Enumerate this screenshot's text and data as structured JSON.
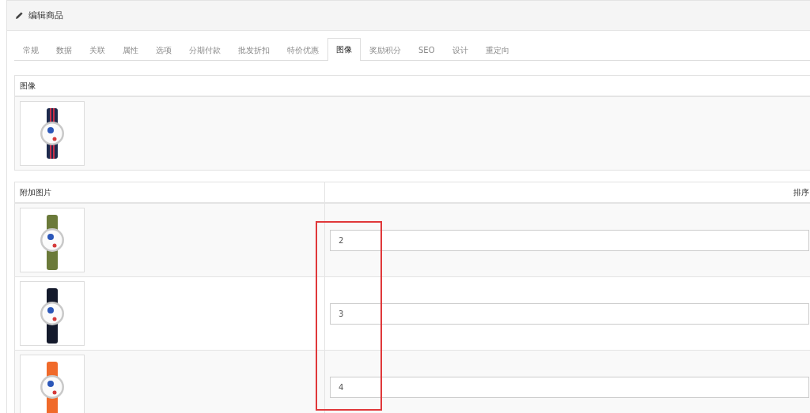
{
  "panel": {
    "title": "编辑商品"
  },
  "tabs": [
    {
      "label": "常规",
      "selected": false
    },
    {
      "label": "数据",
      "selected": false
    },
    {
      "label": "关联",
      "selected": false
    },
    {
      "label": "属性",
      "selected": false
    },
    {
      "label": "选项",
      "selected": false
    },
    {
      "label": "分期付款",
      "selected": false
    },
    {
      "label": "批发折扣",
      "selected": false
    },
    {
      "label": "特价优惠",
      "selected": false
    },
    {
      "label": "图像",
      "selected": true
    },
    {
      "label": "奖励积分",
      "selected": false
    },
    {
      "label": "SEO",
      "selected": false
    },
    {
      "label": "设计",
      "selected": false
    },
    {
      "label": "重定向",
      "selected": false
    }
  ],
  "main_image": {
    "heading": "图像"
  },
  "additional_images": {
    "columns": [
      "附加图片",
      "排序"
    ],
    "rows": [
      {
        "sort_order": "2"
      },
      {
        "sort_order": "3"
      },
      {
        "sort_order": "4"
      }
    ]
  }
}
